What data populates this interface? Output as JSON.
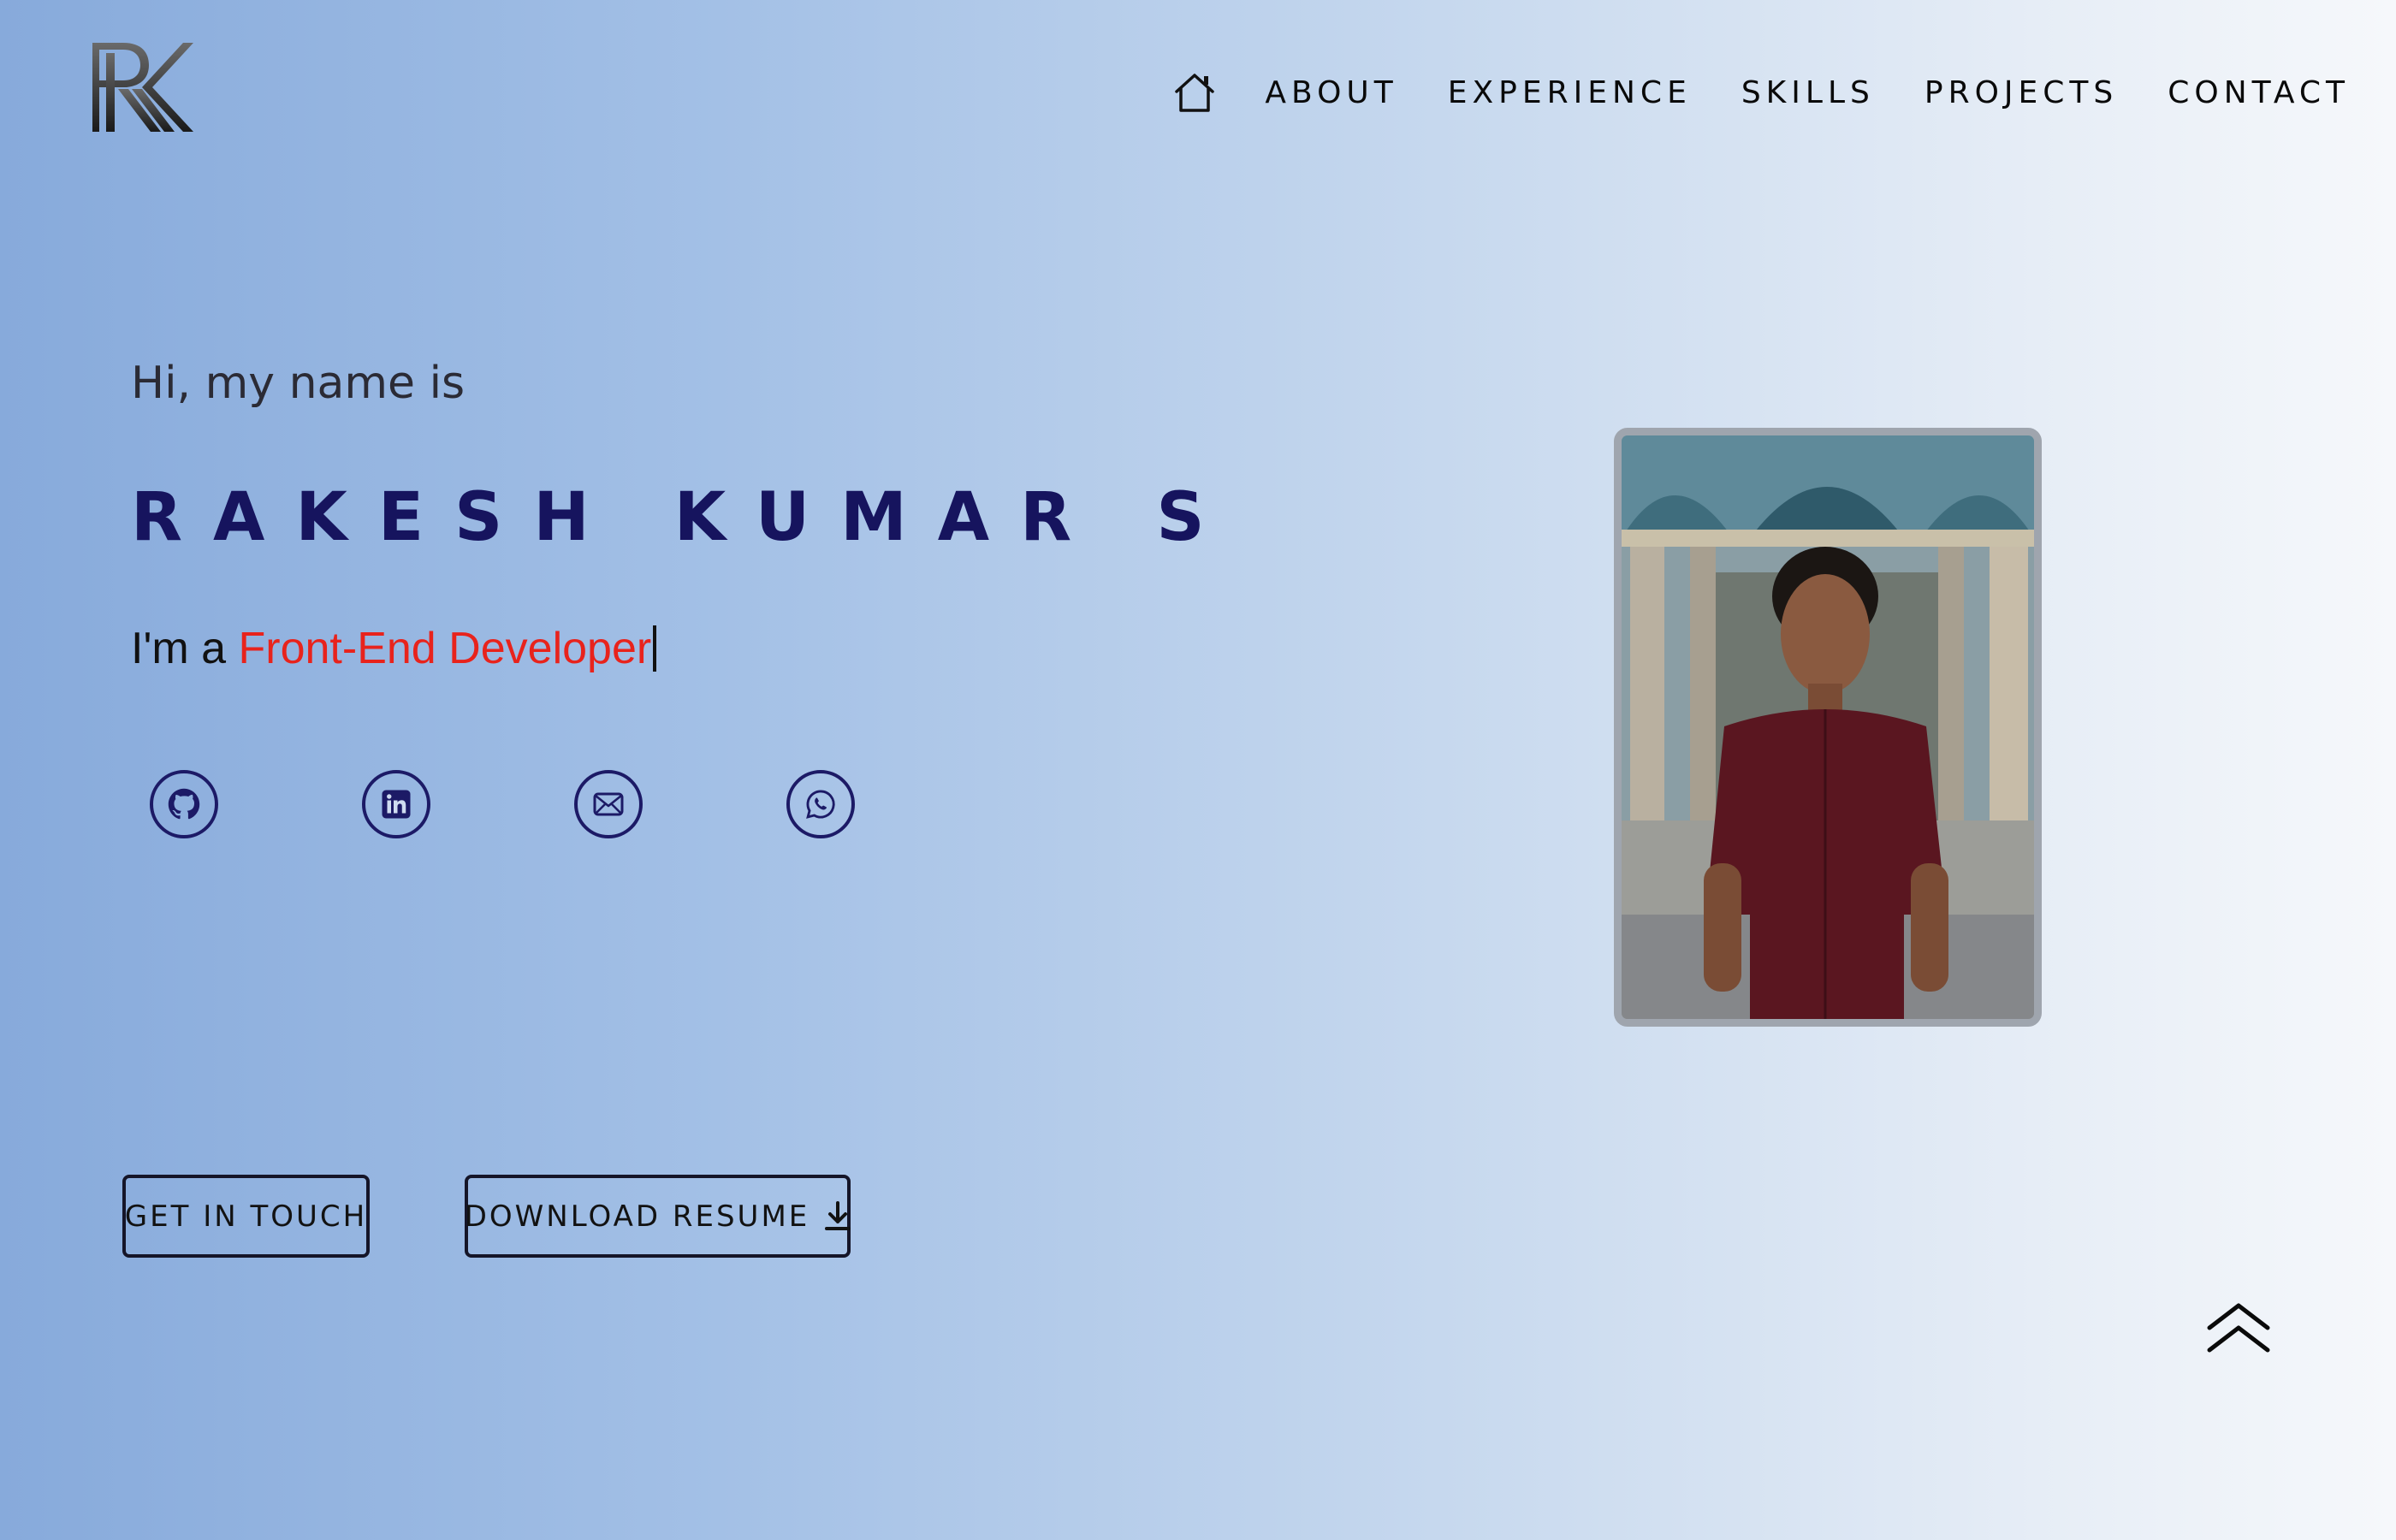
{
  "logo": {
    "text": "RK"
  },
  "nav": {
    "home_icon": "home-icon",
    "items": [
      {
        "label": "ABOUT"
      },
      {
        "label": "EXPERIENCE"
      },
      {
        "label": "SKILLS"
      },
      {
        "label": "PROJECTS"
      },
      {
        "label": "CONTACT"
      }
    ]
  },
  "hero": {
    "greeting": "Hi, my name is",
    "name": "RAKESH KUMAR S",
    "role_prefix": "I'm a ",
    "role_highlight": "Front-End Developer",
    "socials": [
      {
        "icon": "github-icon"
      },
      {
        "icon": "linkedin-icon"
      },
      {
        "icon": "mail-icon"
      },
      {
        "icon": "whatsapp-icon"
      }
    ],
    "buttons": {
      "touch": "GET IN TOUCH",
      "resume": "DOWNLOAD RESUME",
      "resume_icon": "download-icon"
    }
  },
  "photo": {
    "subject": "profile-photo"
  },
  "scroll_top": {
    "icon": "double-chevron-up-icon"
  },
  "colors": {
    "name": "#16145e",
    "accent": "#e8231c",
    "icon_border": "#1c1a66"
  }
}
